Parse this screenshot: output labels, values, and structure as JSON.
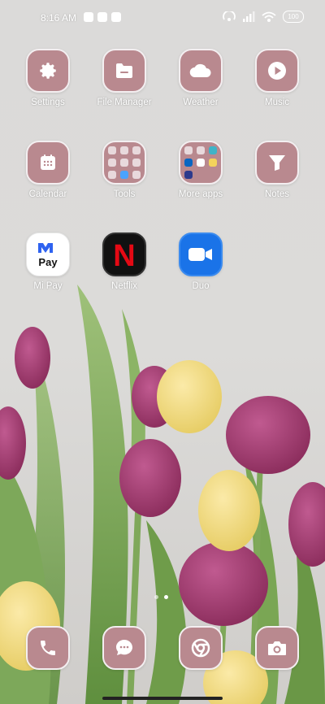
{
  "status_bar": {
    "time": "8:16 AM",
    "battery": "100"
  },
  "apps": [
    {
      "label": "Settings",
      "icon": "gear-icon"
    },
    {
      "label": "File Manager",
      "icon": "folder-icon"
    },
    {
      "label": "Weather",
      "icon": "cloud-icon"
    },
    {
      "label": "Music",
      "icon": "play-icon"
    },
    {
      "label": "Calendar",
      "icon": "calendar-icon"
    },
    {
      "label": "Tools",
      "icon": "folder-grid-icon"
    },
    {
      "label": "More apps",
      "icon": "folder-grid-icon"
    },
    {
      "label": "Notes",
      "icon": "funnel-icon"
    },
    {
      "label": "Mi Pay",
      "icon": "mipay-icon",
      "logo_text": "Pay"
    },
    {
      "label": "Netflix",
      "icon": "netflix-icon",
      "logo_text": "N"
    },
    {
      "label": "Duo",
      "icon": "video-camera-icon"
    }
  ],
  "dock": [
    {
      "label": "Phone",
      "icon": "phone-icon"
    },
    {
      "label": "Messages",
      "icon": "chat-bubble-icon"
    },
    {
      "label": "Chrome",
      "icon": "chrome-icon"
    },
    {
      "label": "Camera",
      "icon": "camera-icon"
    }
  ],
  "colors": {
    "tile": "#b9898f",
    "tile_border": "#f3eef0",
    "netflix_red": "#e50914",
    "duo_blue": "#1a73e8"
  }
}
